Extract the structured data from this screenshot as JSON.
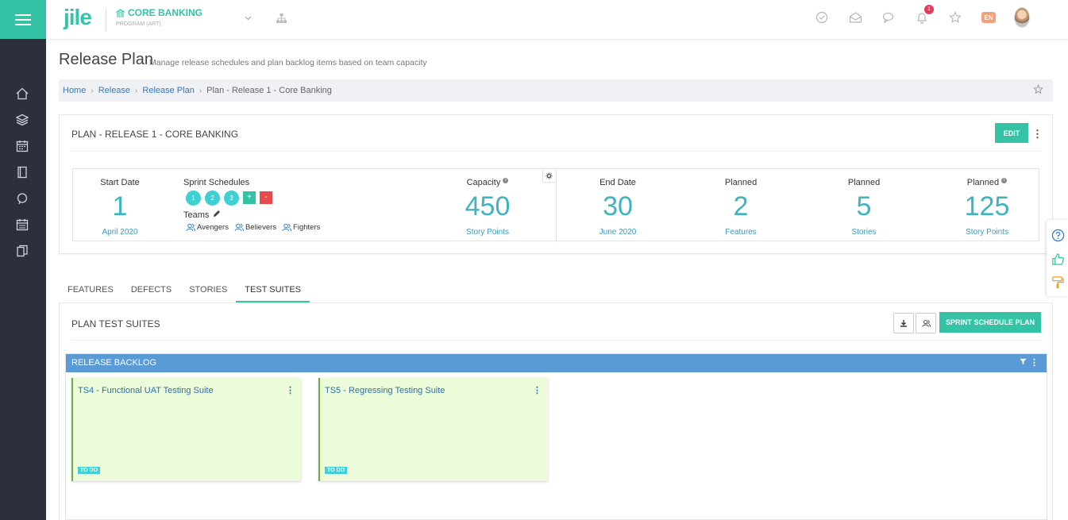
{
  "app": {
    "logo_text": "jile",
    "program_name": "CORE BANKING",
    "program_type": "PROGRAM (ART)",
    "notification_count": "1",
    "language": "EN"
  },
  "page": {
    "title": "Release Plan",
    "subtitle": "Manage release schedules and plan backlog items based on team capacity"
  },
  "breadcrumb": {
    "items": [
      "Home",
      "Release",
      "Release Plan"
    ],
    "current": "Plan - Release 1 - Core Banking"
  },
  "plan": {
    "title": "PLAN - RELEASE 1 - CORE BANKING",
    "edit_label": "EDIT",
    "start": {
      "label": "Start Date",
      "value": "1",
      "sub": "April 2020"
    },
    "sprint_schedules_label": "Sprint Schedules",
    "sprints": [
      "1",
      "2",
      "3"
    ],
    "add_label": "+",
    "remove_label": "-",
    "teams_label": "Teams",
    "teams": [
      "Avengers",
      "Believers",
      "Fighters"
    ],
    "capacity": {
      "label": "Capacity",
      "value": "450",
      "sub": "Story Points"
    },
    "end": {
      "label": "End Date",
      "value": "30",
      "sub": "June 2020"
    },
    "planned_features": {
      "label": "Planned",
      "value": "2",
      "sub": "Features"
    },
    "planned_stories": {
      "label": "Planned",
      "value": "5",
      "sub": "Stories"
    },
    "planned_points": {
      "label": "Planned",
      "value": "125",
      "sub": "Story Points"
    }
  },
  "tabs": [
    "FEATURES",
    "DEFECTS",
    "STORIES",
    "TEST SUITES"
  ],
  "test_suites": {
    "title": "PLAN TEST SUITES",
    "sprint_schedule_button": "SPRINT SCHEDULE PLAN",
    "backlog_title": "RELEASE BACKLOG",
    "cards": [
      {
        "title": "TS4 - Functional UAT Testing Suite",
        "status": "TO DO"
      },
      {
        "title": "TS5 - Regressing Testing Suite",
        "status": "TO DO"
      }
    ]
  },
  "colors": {
    "accent": "#35c3a6",
    "sidebar": "#2d2f3d",
    "stat_value": "#3eb4c2",
    "backlog_header": "#5b9bd5",
    "card_bg": "#ecfbd9"
  }
}
